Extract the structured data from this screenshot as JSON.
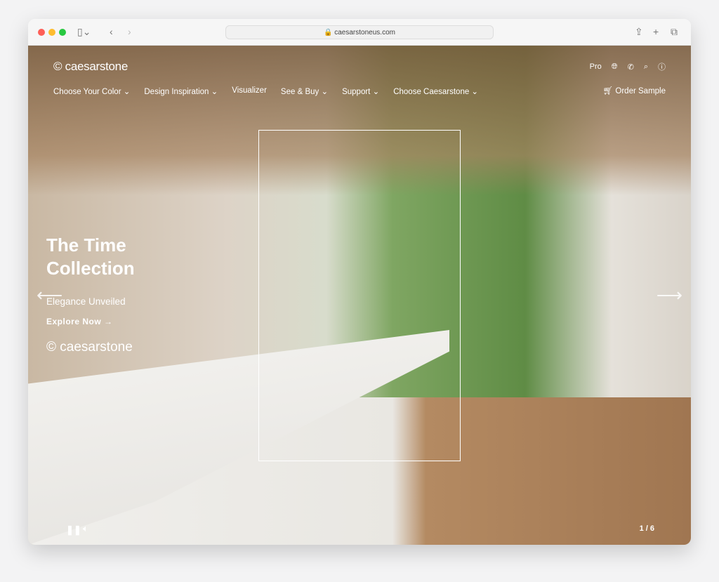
{
  "browser": {
    "url": "caesarstoneus.com"
  },
  "header": {
    "logo": "caesarstone",
    "pro": "Pro",
    "order_sample": "Order Sample",
    "nav": [
      "Choose Your Color ⌄",
      "Design Inspiration ⌄",
      "Visualizer",
      "See & Buy ⌄",
      "Support ⌄",
      "Choose Caesarstone ⌄"
    ]
  },
  "hero": {
    "title_line1": "The Time",
    "title_line2": "Collection",
    "subtitle": "Elegance Unveiled",
    "cta": "Explore Now",
    "logo": "caesarstone",
    "counter": "1 / 6"
  },
  "icons": {
    "prev": "arrow-left-icon",
    "next": "arrow-right-icon",
    "globe": "globe-icon",
    "phone": "phone-icon",
    "search": "search-icon",
    "accessibility": "accessibility-icon",
    "cart": "cart-icon"
  }
}
